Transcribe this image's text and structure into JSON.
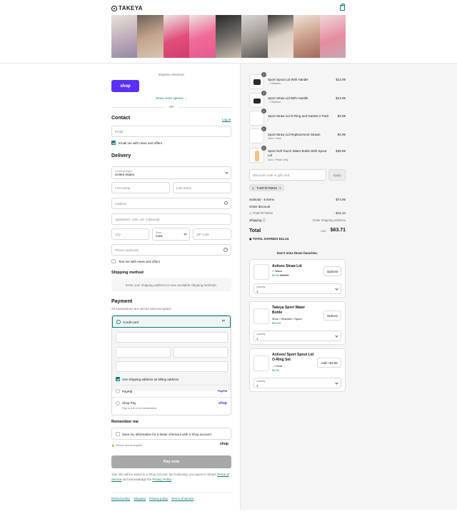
{
  "brand": {
    "name": "TAKEYA"
  },
  "express": {
    "label": "Express checkout",
    "shop_label": "shop",
    "more_options": "Show more options",
    "or": "OR"
  },
  "contact": {
    "title": "Contact",
    "login": "Log in",
    "email_placeholder": "Email",
    "news_label": "Email me with news and offers"
  },
  "delivery": {
    "title": "Delivery",
    "country_label": "Country/Region",
    "country_value": "United States",
    "first_name": "First name",
    "last_name": "Last name",
    "address": "Address",
    "apartment": "Apartment, suite, etc. (optional)",
    "city": "City",
    "state_label": "State",
    "state_value": "Iowa",
    "zip": "ZIP code",
    "phone": "Phone (optional)",
    "text_label": "Text me with news and offers"
  },
  "shipping": {
    "title": "Shipping method",
    "info": "Enter your shipping address to view available shipping methods."
  },
  "payment": {
    "title": "Payment",
    "subtitle": "All transactions are secure and encrypted.",
    "credit_card": "Credit card",
    "billing_label": "Use shipping address as billing address",
    "paypal": "PayPal",
    "paypal_logo": "PayPal",
    "shoppay": "Shop Pay",
    "shoppay_sub": "Pay in full or in installments",
    "shoppay_logo": "shop"
  },
  "remember": {
    "title": "Remember me",
    "save_label": "Save my information for a faster checkout with a Shop account",
    "secure": "Secure and encrypted",
    "shop": "shop"
  },
  "pay_now": "Pay now",
  "legal": {
    "text": "Your info will be saved to a Shop account. By continuing, you agree to Shop's ",
    "terms": "Terms of Service",
    "mid": " and acknowledge the ",
    "privacy": "Privacy Policy",
    "end": "."
  },
  "footer_links": [
    "Refund policy",
    "Shipping",
    "Privacy policy",
    "Terms of service"
  ],
  "cart_items": [
    {
      "qty": "1",
      "name": "Sport Spout Lid With Handle",
      "variant": "- / Obsidian",
      "price": "$12.99"
    },
    {
      "qty": "1",
      "name": "Sport Straw Lid With Handle",
      "variant": "- / Obsidian",
      "price": "$12.99"
    },
    {
      "qty": "1",
      "name": "Sport Straw Lid O-Ring and Gasket 2 Pack",
      "variant": "/",
      "price": "$3.99"
    },
    {
      "qty": "1",
      "name": "Sport Straw Lid Replacement Straws",
      "variant": "16oz / Clear",
      "price": "$4.99"
    },
    {
      "qty": "1",
      "name": "Sport Soft Touch Water Bottle With Spout Lid",
      "variant": "32oz / Peach Jelly",
      "price": "$39.99"
    }
  ],
  "discount": {
    "placeholder": "Discount code or gift card",
    "apply": "Apply",
    "tag": "TAWFIKTWINS",
    "remove": "×"
  },
  "summary": {
    "subtotal_label": "Subtotal · 5 items",
    "subtotal": "$74.95",
    "order_discount": "Order discount",
    "code": "TAWFIKTWINS",
    "discount_value": "- $11.24",
    "shipping_label": "Shipping",
    "shipping_value": "Enter shipping address",
    "total_label": "Total",
    "currency": "USD",
    "total": "$63.71",
    "savings_label": "TOTAL SAVINGS",
    "savings": "$11.24"
  },
  "upsell": {
    "title": "Don't miss these favorites.",
    "products": [
      {
        "title": "Actives Straw Lid",
        "variant": "/ / Black",
        "price": "$9.99",
        "compare": "$14.99",
        "button": "Options",
        "qty_label": "Quantity",
        "qty": "1"
      },
      {
        "title": "Takeya Sport Water Bottle",
        "variant": "30oz / Obsidian / Spout",
        "price": "$39.99",
        "compare": "",
        "button": "Options",
        "qty_label": "Quantity",
        "qty": "1"
      },
      {
        "title": "Actives/ Sport Spout Lid O-Ring Set",
        "variant": "- / Clear",
        "price": "$3.99",
        "compare": "",
        "button": "Add • $3.99",
        "qty_label": "Quantity",
        "qty": "1"
      }
    ]
  },
  "colors": {
    "accent": "#117a7a",
    "shop_purple": "#5a31f4",
    "pay_disabled": "#a8a8a8",
    "sidebar_bg": "#f5f5f5"
  }
}
